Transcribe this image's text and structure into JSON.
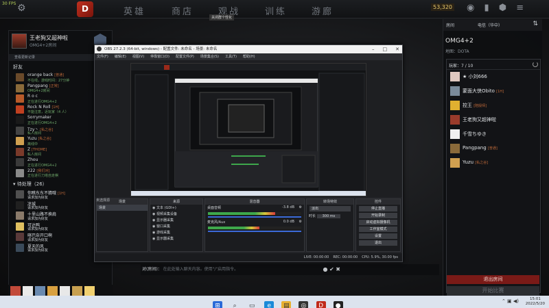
{
  "top": {
    "fps": "30 FPS",
    "nav": [
      "英雄",
      "商店",
      "观战",
      "训练",
      "游廊"
    ],
    "gold": "53,320",
    "tooltip": "关闭群个性化"
  },
  "profile": {
    "name": "王老狗又超神啦",
    "room": "OMG4+2房间",
    "view": "查看更新记录"
  },
  "friends_header": "好友",
  "friends": [
    {
      "name": "orange back",
      "tag": "[普通]",
      "status": "不在线，游戏时间：27分钟",
      "color": "#6a4a2a"
    },
    {
      "name": "Pangpang",
      "tag": "[正常]",
      "status": "OMG4+2房间",
      "color": "#8a6a3a"
    },
    {
      "name": "R o c",
      "tag": "",
      "status": "正在进行OMG4+2",
      "color": "#b85a2a"
    },
    {
      "name": "Rock N Roll",
      "tag": "[1H]",
      "status": "不能注意，近玩家（4 人）",
      "color": "#c04020"
    },
    {
      "name": "Sorrymaker",
      "tag": "",
      "status": "正在进行OMG4+2",
      "color": "#1a1a1a"
    },
    {
      "name": "Tzy丶",
      "tag": "[私之谷]",
      "status": "私人房间",
      "color": "#444"
    },
    {
      "name": "Yuzu",
      "tag": "[私之谷]",
      "status": "离线中",
      "color": "#d0a050"
    },
    {
      "name": "Z",
      "tag": "[THOME]",
      "status": "私人房间",
      "color": "#7a3a2a"
    },
    {
      "name": "Zhou",
      "tag": "",
      "status": "正在进行OMG4+2",
      "color": "#3a3a3a"
    },
    {
      "name": "222",
      "tag": "[我们对]",
      "status": "正在进行刀塔自走棋",
      "color": "#8a8a8a"
    }
  ],
  "pending_header": "待处理（26）",
  "pending": [
    {
      "name": "你瞧东东不猜哦",
      "tag": "[1H]",
      "status": "请求加为好友",
      "color": "#505050"
    },
    {
      "name": "凉城",
      "tag": "",
      "status": "请求加为好友",
      "color": "#202020"
    },
    {
      "name": "十里山路不换肩",
      "tag": "",
      "status": "请求加为好友",
      "color": "#8a7a6a"
    },
    {
      "name": "可达鸭",
      "tag": "",
      "status": "请求加为好友",
      "color": "#e0c060"
    },
    {
      "name": "喀巴奈开口啊",
      "tag": "",
      "status": "请求加为好友",
      "color": "#5a3a3a"
    },
    {
      "name": "夏天的风",
      "tag": "",
      "status": "请求加为好友",
      "color": "#3a4a5a"
    }
  ],
  "strip_colors": [
    "#c24a3a",
    "#eaeaea",
    "#6a8ab0",
    "#d8a040",
    "#e8e8e8",
    "#c8a050",
    "#f0d070"
  ],
  "room": {
    "header_label": "房间",
    "region": "电信（华中）",
    "title": "OMG4+2",
    "map": "地图：DOTA",
    "players_label": "玩家：7 / 10",
    "players": [
      {
        "name": "★ 小刘666",
        "tag": "",
        "color": "#e0c8c0"
      },
      {
        "name": "蒙面大侠Obito",
        "tag": "[1H]",
        "color": "#7a8a9a"
      },
      {
        "name": "控王",
        "tag": "[陪骰师]",
        "color": "#e0b030"
      },
      {
        "name": "王老狗又超神啦",
        "tag": "",
        "color": "#9a3b2b"
      },
      {
        "name": "千雪ちゆき",
        "tag": "",
        "color": "#f0f0f0"
      },
      {
        "name": "Pangpang",
        "tag": "[普通]",
        "color": "#8a6a3a"
      },
      {
        "name": "Yuzu",
        "tag": "[私之谷]",
        "color": "#d0a050"
      }
    ],
    "leave": "退出房间",
    "start": "开始比赛"
  },
  "chat": {
    "tag": "对(房间)：",
    "placeholder": "在此处输入聊天内容。使用\"/\"启用指令。"
  },
  "obs": {
    "title": "OBS 27.2.3 (64-bit, windows) - 配置文件: 未命名 - 场景: 未命名",
    "menu": [
      "文件(F)",
      "编辑(E)",
      "视图(V)",
      "停靠窗口(D)",
      "配置文件(P)",
      "场景集合(S)",
      "工具(T)",
      "帮助(H)"
    ],
    "dock_titles": [
      "场景",
      "来源",
      "混音器",
      "转场特效",
      "控件"
    ],
    "scenes": [
      "场景"
    ],
    "sources": [
      "文本 (GDI+)",
      "视频采集设备",
      "显示器采集",
      "窗口采集",
      "游戏采集",
      "显示器采集"
    ],
    "mixer": [
      {
        "name": "桌面音频",
        "db": "-3.8 dB",
        "level": 0.72
      },
      {
        "name": "麦克风/Aux",
        "db": "0.0 dB",
        "level": 0.55
      }
    ],
    "transition": "淡出",
    "duration_label": "时长",
    "duration": "300 ms",
    "controls": [
      "停止直播",
      "开始录制",
      "启动虚拟摄像机",
      "工作室模式",
      "设置",
      "退出"
    ],
    "status": [
      "LIVE: 00:00:00",
      "REC: 00:00:00",
      "CPU: 5.9%, 30.00 fps"
    ],
    "no_source": "未选择源"
  },
  "clock": {
    "time": "15:01",
    "date": "2022/5/20"
  }
}
